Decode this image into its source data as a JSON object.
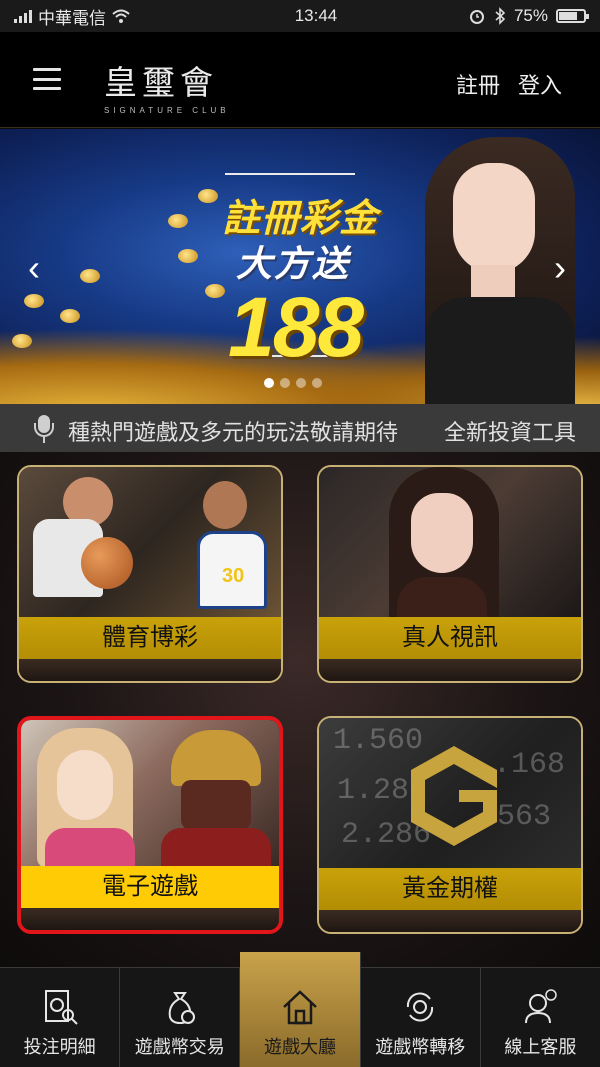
{
  "status_bar": {
    "carrier": "中華電信",
    "time": "13:44",
    "battery": "75%",
    "battery_level": 0.75
  },
  "header": {
    "logo_text": "皇璽會",
    "logo_sub": "SIGNATURE CLUB",
    "register_label": "註冊",
    "login_label": "登入"
  },
  "banner": {
    "title": "註冊彩金",
    "subtitle": "大方送",
    "amount": "188",
    "slide_count": 4,
    "active_slide": 0
  },
  "marquee": {
    "text_1": "種熱門遊戲及多元的玩法敬請期待",
    "text_2": "全新投資工具"
  },
  "games": {
    "sports": "體育博彩",
    "live": "真人視訊",
    "slots": "電子遊戲",
    "options": "黃金期權",
    "selected": "電子遊戲"
  },
  "bottom_nav": {
    "bets": "投注明細",
    "exchange": "遊戲幣交易",
    "lobby": "遊戲大廳",
    "transfer": "遊戲幣轉移",
    "support": "線上客服",
    "active": "遊戲大廳"
  },
  "colors": {
    "gold": "#c9a20a",
    "selected_border": "#e0161a"
  }
}
